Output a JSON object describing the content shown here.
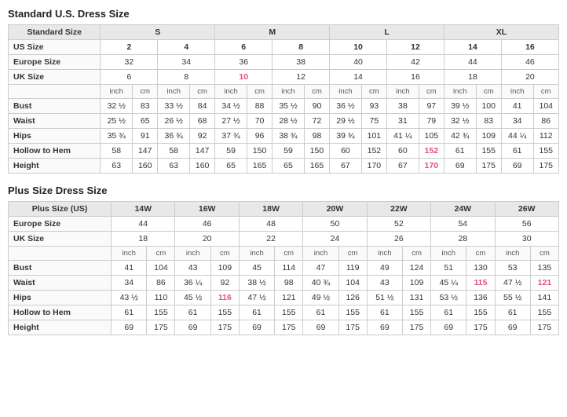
{
  "standard_title": "Standard U.S. Dress Size",
  "plus_title": "Plus Size Dress Size",
  "standard_table": {
    "size_groups": [
      {
        "label": "Standard Size",
        "colspan": 1
      },
      {
        "label": "S",
        "colspan": 4
      },
      {
        "label": "M",
        "colspan": 4
      },
      {
        "label": "L",
        "colspan": 4
      },
      {
        "label": "XL",
        "colspan": 4
      }
    ],
    "us_sizes": [
      "US Size",
      "2",
      "4",
      "6",
      "8",
      "10",
      "12",
      "14",
      "16"
    ],
    "europe_sizes": [
      "Europe Size",
      "32",
      "34",
      "36",
      "38",
      "40",
      "42",
      "44",
      "46"
    ],
    "uk_sizes": [
      "UK Size",
      "6",
      "8",
      "10",
      "12",
      "14",
      "16",
      "18",
      "20"
    ],
    "unit_row": [
      "",
      "inch",
      "cm",
      "inch",
      "cm",
      "inch",
      "cm",
      "inch",
      "cm",
      "inch",
      "cm",
      "inch",
      "cm",
      "inch",
      "cm",
      "inch",
      "cm"
    ],
    "bust": [
      "Bust",
      "32 ½",
      "83",
      "33 ½",
      "84",
      "34 ½",
      "88",
      "35 ½",
      "90",
      "36 ½",
      "93",
      "38",
      "97",
      "39 ½",
      "100",
      "41",
      "104"
    ],
    "waist": [
      "Waist",
      "25 ½",
      "65",
      "26 ½",
      "68",
      "27 ½",
      "70",
      "28 ½",
      "72",
      "29 ½",
      "75",
      "31",
      "79",
      "32 ½",
      "83",
      "34",
      "86"
    ],
    "hips": [
      "Hips",
      "35 ¾",
      "91",
      "36 ¾",
      "92",
      "37 ¾",
      "96",
      "38 ¾",
      "98",
      "39 ¾",
      "101",
      "41 ¼",
      "105",
      "42 ¾",
      "109",
      "44 ¼",
      "112"
    ],
    "hollow_hem": [
      "Hollow to Hem",
      "58",
      "147",
      "58",
      "147",
      "59",
      "150",
      "59",
      "150",
      "60",
      "152",
      "60",
      "152",
      "61",
      "155",
      "61",
      "155"
    ],
    "height": [
      "Height",
      "63",
      "160",
      "63",
      "160",
      "65",
      "165",
      "65",
      "165",
      "67",
      "170",
      "67",
      "170",
      "69",
      "175",
      "69",
      "175"
    ],
    "pink_cols_us": [
      5,
      9
    ],
    "pink_cols_uk": [
      3
    ]
  },
  "plus_table": {
    "size_groups": [
      {
        "label": "Plus Size (US)",
        "colspan": 1
      },
      {
        "label": "14W",
        "colspan": 2
      },
      {
        "label": "16W",
        "colspan": 2
      },
      {
        "label": "18W",
        "colspan": 2
      },
      {
        "label": "20W",
        "colspan": 2
      },
      {
        "label": "22W",
        "colspan": 2
      },
      {
        "label": "24W",
        "colspan": 2
      },
      {
        "label": "26W",
        "colspan": 2
      }
    ],
    "europe_sizes": [
      "Europe Size",
      "44",
      "46",
      "48",
      "50",
      "52",
      "54",
      "56"
    ],
    "uk_sizes": [
      "UK Size",
      "18",
      "20",
      "22",
      "24",
      "26",
      "28",
      "30"
    ],
    "unit_row": [
      "",
      "inch",
      "cm",
      "inch",
      "cm",
      "inch",
      "cm",
      "inch",
      "cm",
      "inch",
      "cm",
      "inch",
      "cm",
      "inch",
      "cm"
    ],
    "bust": [
      "Bust",
      "41",
      "104",
      "43",
      "109",
      "45",
      "114",
      "47",
      "119",
      "49",
      "124",
      "51",
      "130",
      "53",
      "135"
    ],
    "waist": [
      "Waist",
      "34",
      "86",
      "36 ¼",
      "92",
      "38 ½",
      "98",
      "40 ¾",
      "104",
      "43",
      "109",
      "45 ¼",
      "115",
      "47 ½",
      "121"
    ],
    "hips": [
      "Hips",
      "43 ½",
      "110",
      "45 ½",
      "116",
      "47 ½",
      "121",
      "49 ½",
      "126",
      "51 ½",
      "131",
      "53 ½",
      "136",
      "55 ½",
      "141"
    ],
    "hollow_hem": [
      "Hollow to Hem",
      "61",
      "155",
      "61",
      "155",
      "61",
      "155",
      "61",
      "155",
      "61",
      "155",
      "61",
      "155",
      "61",
      "155"
    ],
    "height": [
      "Height",
      "69",
      "175",
      "69",
      "175",
      "69",
      "175",
      "69",
      "175",
      "69",
      "175",
      "69",
      "175",
      "69",
      "175"
    ],
    "pink_cols": [
      6,
      9,
      10,
      11,
      14
    ]
  }
}
